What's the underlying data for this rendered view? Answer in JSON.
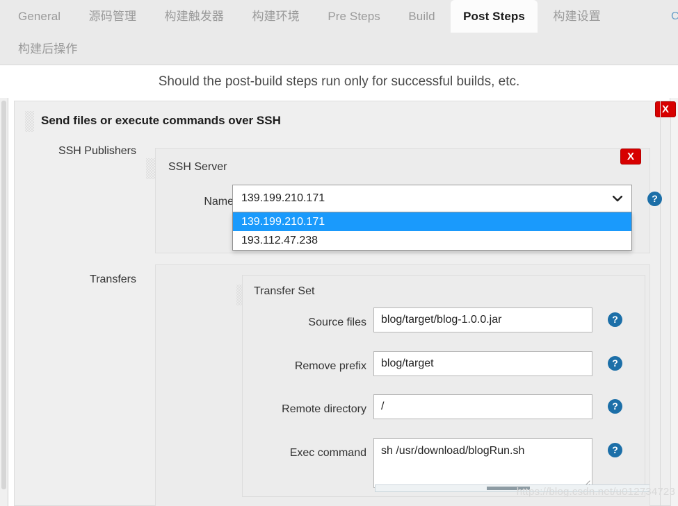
{
  "tabs": {
    "row1": [
      {
        "label": "General",
        "active": false
      },
      {
        "label": "源码管理",
        "active": false
      },
      {
        "label": "构建触发器",
        "active": false
      },
      {
        "label": "构建环境",
        "active": false
      },
      {
        "label": "Pre Steps",
        "active": false
      },
      {
        "label": "Build",
        "active": false
      },
      {
        "label": "Post Steps",
        "active": true
      },
      {
        "label": "构建设置",
        "active": false
      }
    ],
    "row2": [
      {
        "label": "构建后操作",
        "active": false
      }
    ],
    "edge_partial": "C"
  },
  "subtitle": "Should the post-build steps run only for successful builds, etc.",
  "panel": {
    "title": "Send files or execute commands over SSH",
    "close_label": "X"
  },
  "ssh_publishers": {
    "label": "SSH Publishers",
    "ssh_server": {
      "title": "SSH Server",
      "close_label": "X",
      "name_label": "Name",
      "name_value": "139.199.210.171",
      "help_label": "?",
      "dropdown_open": true,
      "options": [
        {
          "label": "139.199.210.171",
          "selected": true
        },
        {
          "label": "193.112.47.238",
          "selected": false
        }
      ],
      "chevron": "chevron-down"
    }
  },
  "transfers": {
    "label": "Transfers",
    "transfer_set": {
      "title": "Transfer Set",
      "fields": [
        {
          "label": "Source files",
          "value": "blog/target/blog-1.0.0.jar",
          "type": "text",
          "help": "?"
        },
        {
          "label": "Remove prefix",
          "value": "blog/target",
          "type": "text",
          "help": "?"
        },
        {
          "label": "Remote directory",
          "value": "/",
          "type": "text",
          "help": "?"
        },
        {
          "label": "Exec command",
          "value": "sh /usr/download/blogRun.sh",
          "type": "textarea",
          "help": "?"
        }
      ]
    }
  },
  "watermark": "https://blog.csdn.net/u012734723",
  "colors": {
    "accent_blue": "#1a9afc",
    "help_blue": "#1c6fa8",
    "danger_red": "#d70000",
    "panel_bg": "#efefef",
    "tabbar_bg": "#eaeaea"
  }
}
